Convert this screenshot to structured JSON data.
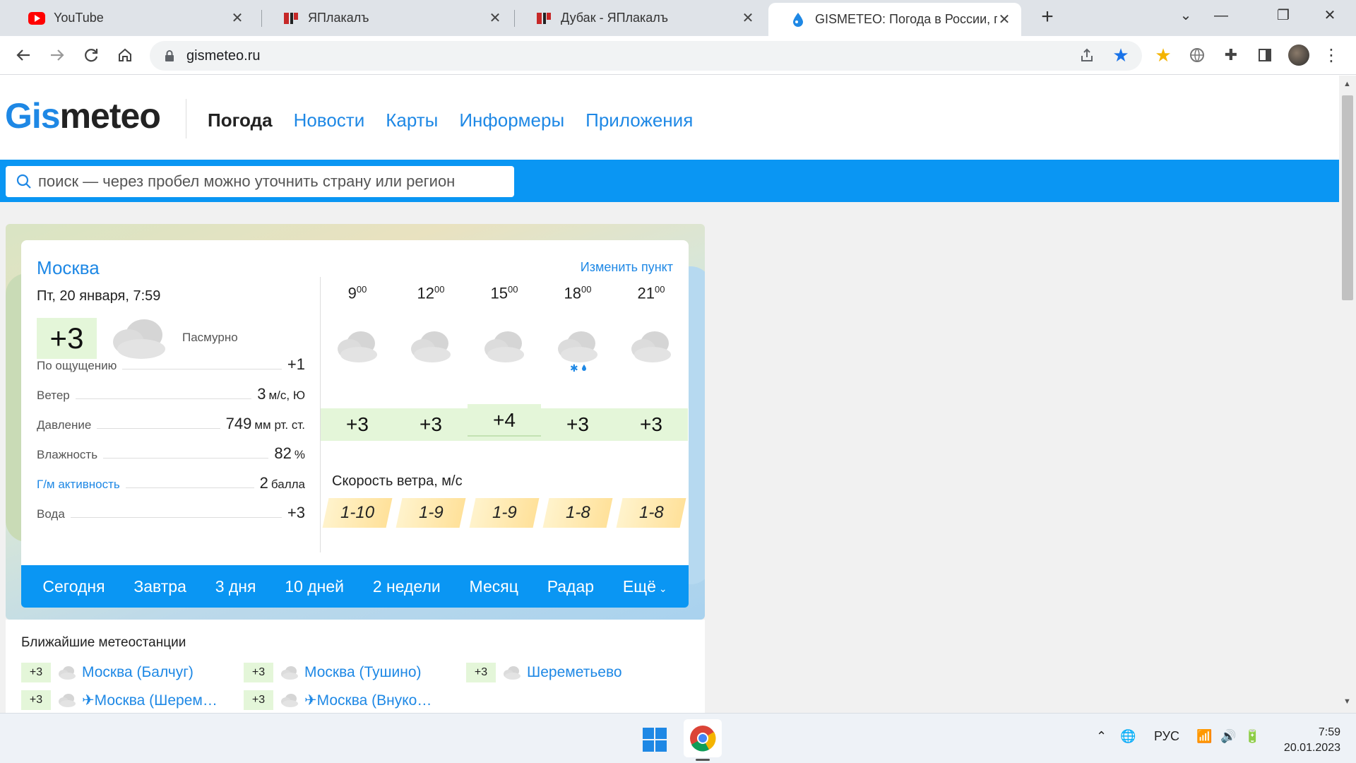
{
  "browser": {
    "tabs": [
      {
        "title": "YouTube",
        "icon": "youtube-icon"
      },
      {
        "title": "ЯПлакалъ",
        "icon": "yaplakal-icon"
      },
      {
        "title": "Дубак - ЯПлакалъ",
        "icon": "yaplakal-icon"
      },
      {
        "title": "GISMETEO: Погода в России, пр",
        "icon": "gismeteo-drop-icon",
        "active": true
      }
    ],
    "url": "gismeteo.ru"
  },
  "site": {
    "logo_a": "Gis",
    "logo_b": "meteo",
    "nav": [
      "Погода",
      "Новости",
      "Карты",
      "Информеры",
      "Приложения"
    ],
    "search_placeholder": "поиск — через пробел можно уточнить страну или регион"
  },
  "weather": {
    "city": "Москва",
    "change_link": "Изменить пункт",
    "date": "Пт, 20 января, 7:59",
    "now_temp": "+3",
    "condition": "Пасмурно",
    "params": [
      {
        "label": "По ощущению",
        "value": "+1",
        "unit": ""
      },
      {
        "label": "Ветер",
        "value": "3",
        "unit": "м/с, Ю"
      },
      {
        "label": "Давление",
        "value": "749",
        "unit": "мм рт. ст."
      },
      {
        "label": "Влажность",
        "value": "82",
        "unit": "%"
      },
      {
        "label": "Г/м активность",
        "value": "2",
        "unit": "балла"
      },
      {
        "label": "Вода",
        "value": "+3",
        "unit": ""
      }
    ],
    "hours": [
      {
        "h": "9",
        "m": "00",
        "temp": "+3",
        "wind": "1-10",
        "icon": "cloud-icon"
      },
      {
        "h": "12",
        "m": "00",
        "temp": "+3",
        "wind": "1-9",
        "icon": "cloud-icon"
      },
      {
        "h": "15",
        "m": "00",
        "temp": "+4",
        "wind": "1-9",
        "icon": "cloud-icon"
      },
      {
        "h": "18",
        "m": "00",
        "temp": "+3",
        "wind": "1-8",
        "icon": "cloud-snow-rain-icon"
      },
      {
        "h": "21",
        "m": "00",
        "temp": "+3",
        "wind": "1-8",
        "icon": "cloud-icon"
      }
    ],
    "wind_title": "Скорость ветра, м/с",
    "period_tabs": [
      "Сегодня",
      "Завтра",
      "3 дня",
      "10 дней",
      "2 недели",
      "Месяц",
      "Радар",
      "Ещё"
    ]
  },
  "stations": {
    "title": "Ближайшие метеостанции",
    "items": [
      {
        "temp": "+3",
        "name": "Москва (Балчуг)",
        "plane": false
      },
      {
        "temp": "+3",
        "name": "Москва (Тушино)",
        "plane": false
      },
      {
        "temp": "+3",
        "name": "Шереметьево",
        "plane": false
      },
      {
        "temp": "+3",
        "name": "✈Москва (Шерем…",
        "plane": true
      },
      {
        "temp": "+3",
        "name": "✈Москва (Внуко…",
        "plane": true
      }
    ]
  },
  "taskbar": {
    "lang": "РУС",
    "time": "7:59",
    "date": "20.01.2023"
  }
}
